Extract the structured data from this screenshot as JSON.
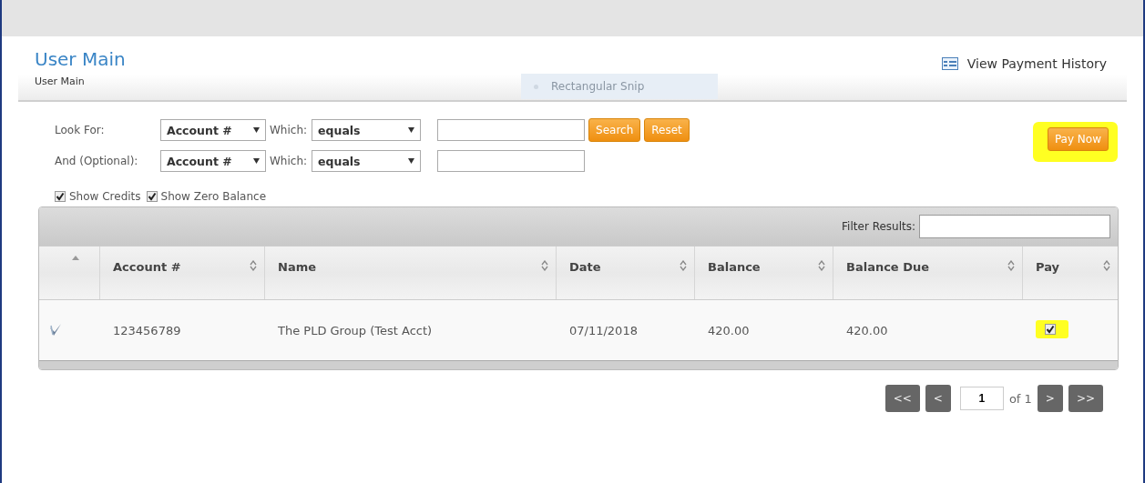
{
  "header": {
    "title": "User Main",
    "breadcrumb": "User Main",
    "history_link": "View Payment History"
  },
  "snip_overlay": {
    "label": "Rectangular Snip"
  },
  "search": {
    "rows": [
      {
        "label": "Look For:",
        "field": "Account #",
        "which_label": "Which:",
        "operator": "equals"
      },
      {
        "label": "And (Optional):",
        "field": "Account #",
        "which_label": "Which:",
        "operator": "equals"
      }
    ],
    "buttons": [
      "Search",
      "Reset"
    ],
    "pay_button": {
      "label": "Pay Now",
      "highlighted": true
    },
    "options": [
      {
        "label": "Show Credits",
        "checked": true
      },
      {
        "label": "Show Zero Balance",
        "checked": true
      }
    ]
  },
  "table": {
    "filter_label": "Filter Results:",
    "columns": [
      "Account #",
      "Name",
      "Date",
      "Balance",
      "Balance Due",
      "Pay"
    ],
    "rows": [
      {
        "cells": [
          "123456789",
          "The PLD Group (Test Acct)",
          "07/11/2018",
          "420.00",
          "420.00"
        ],
        "pay": true,
        "highlighted": true
      }
    ]
  },
  "pager": {
    "buttons": [
      "<<",
      "<"
    ],
    "page": "1",
    "of": "of 1",
    "next_buttons": [
      ">",
      ">>"
    ]
  }
}
